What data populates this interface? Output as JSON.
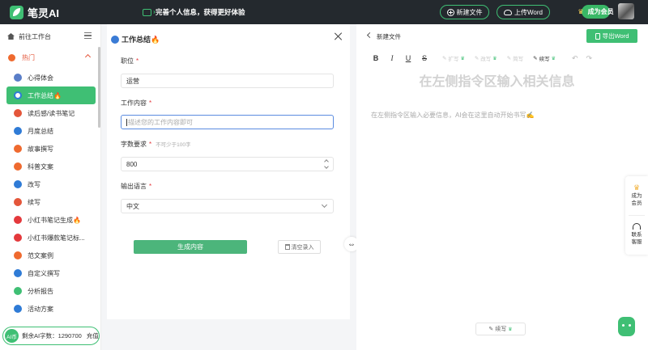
{
  "app": {
    "name": "笔灵AI",
    "promo": "完善个人信息，获得更好体验",
    "new_file": "新建文件",
    "upload_word": "上传Word",
    "vip": "成为会员"
  },
  "sidebar": {
    "workbench": "前往工作台",
    "section": "热门",
    "items": [
      {
        "label": "心得体会",
        "icon": "heart-note-icon",
        "color": "#5a7ec8"
      },
      {
        "label": "工作总结🔥",
        "icon": "briefcase-icon",
        "color": "#2f7bd6"
      },
      {
        "label": "读后感/读书笔记",
        "icon": "book-icon",
        "color": "#e4563a"
      },
      {
        "label": "月度总结",
        "icon": "calendar-icon",
        "color": "#2f7bd6"
      },
      {
        "label": "故事撰写",
        "icon": "story-icon",
        "color": "#ef6a2f"
      },
      {
        "label": "科普文案",
        "icon": "science-icon",
        "color": "#ef6a2f"
      },
      {
        "label": "改写",
        "icon": "rewrite-icon",
        "color": "#2f7bd6"
      },
      {
        "label": "续写",
        "icon": "continue-icon",
        "color": "#e4563a"
      },
      {
        "label": "小红书笔记生成🔥",
        "icon": "xiaohongshu-icon",
        "color": "#e4393c"
      },
      {
        "label": "小红书爆款笔记标...",
        "icon": "xiaohongshu-icon",
        "color": "#e4393c"
      },
      {
        "label": "范文案例",
        "icon": "sample-icon",
        "color": "#ef6a2f"
      },
      {
        "label": "自定义撰写",
        "icon": "custom-write-icon",
        "color": "#2f7bd6"
      },
      {
        "label": "分析报告",
        "icon": "report-icon",
        "color": "#3fbf74"
      },
      {
        "label": "活动方案",
        "icon": "event-plan-icon",
        "color": "#2f7bd6"
      }
    ],
    "credit_badge": "AI币",
    "credit_text": "剩余AI字数：1290700",
    "recharge": "充值"
  },
  "form": {
    "title": "工作总结🔥",
    "position_label": "职位",
    "position_value": "运营",
    "content_label": "工作内容",
    "content_placeholder": "描述您的工作内容即可",
    "words_label": "字数要求",
    "words_hint": "不可少于100字",
    "words_value": "800",
    "lang_label": "输出语言",
    "lang_value": "中文",
    "required_mark": "*",
    "generate": "生成内容",
    "clear": "清空录入"
  },
  "editor": {
    "filename": "新建文件",
    "export": "导出Word",
    "tools": {
      "bold": "B",
      "italic": "I",
      "underline": "U",
      "strike": "S"
    },
    "ai_tools": [
      "扩写",
      "改写",
      "简写",
      "续写"
    ],
    "title_placeholder": "在左侧指令区输入相关信息",
    "hint": "在左侧指令区输入必要信息，AI会在这里自动开始书写✍️",
    "continue": "续写"
  },
  "rail": {
    "vip": "成为会员",
    "service": "联系客服"
  }
}
